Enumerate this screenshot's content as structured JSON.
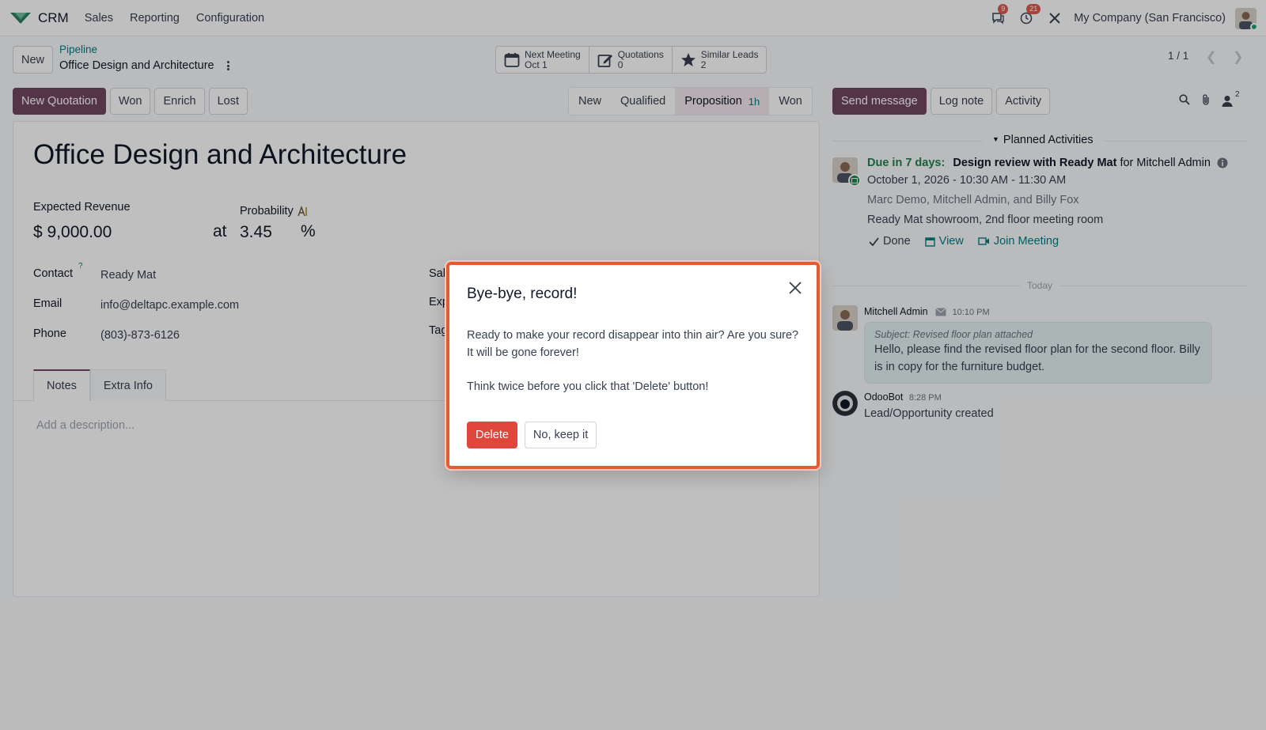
{
  "navbar": {
    "app_name": "CRM",
    "menu": [
      "Sales",
      "Reporting",
      "Configuration"
    ],
    "messages_badge": "9",
    "activities_badge": "21",
    "company": "My Company (San Francisco)"
  },
  "control_panel": {
    "new_label": "New",
    "breadcrumb_parent": "Pipeline",
    "breadcrumb_current": "Office Design and Architecture",
    "smart_buttons": [
      {
        "label": "Next Meeting",
        "value": "Oct 1",
        "icon": "calendar-icon"
      },
      {
        "label": "Quotations",
        "value": "0",
        "icon": "edit-icon"
      },
      {
        "label": "Similar Leads",
        "value": "2",
        "icon": "star-icon"
      }
    ],
    "pager": "1 / 1"
  },
  "status_bar": {
    "actions": [
      "New Quotation",
      "Won",
      "Enrich",
      "Lost"
    ],
    "stages": [
      {
        "label": "New",
        "duration": ""
      },
      {
        "label": "Qualified",
        "duration": ""
      },
      {
        "label": "Proposition",
        "duration": "1h"
      },
      {
        "label": "Won",
        "duration": ""
      }
    ],
    "active_stage": "Proposition"
  },
  "form": {
    "title": "Office Design and Architecture",
    "expected_revenue_label": "Expected Revenue",
    "expected_revenue": "$ 9,000.00",
    "at_label": "at",
    "probability_label": "Probability",
    "probability": "3.45",
    "percent": "%",
    "contact_label": "Contact",
    "contact_help": "?",
    "contact": "Ready Mat",
    "email_label": "Email",
    "email": "info@deltapc.example.com",
    "phone_label": "Phone",
    "phone": "(803)-873-6126",
    "right_labels": [
      "Sal",
      "Exp",
      "Tag"
    ],
    "tabs": [
      "Notes",
      "Extra Info"
    ],
    "description_placeholder": "Add a description..."
  },
  "chatter": {
    "buttons": [
      "Send message",
      "Log note",
      "Activity"
    ],
    "followers_count": "2",
    "planned_title": "Planned Activities",
    "activity": {
      "due": "Due in 7 days:",
      "summary": "Design review with Ready Mat",
      "for_text": "for Mitchell Admin",
      "datetime": "October 1, 2026 - 10:30 AM - 11:30 AM",
      "attendees": "Marc Demo, Mitchell Admin, and Billy Fox",
      "location": "Ready Mat showroom, 2nd floor meeting room",
      "done": "Done",
      "view": "View",
      "join": "Join Meeting"
    },
    "today_label": "Today",
    "messages": [
      {
        "author": "Mitchell Admin",
        "time": "10:10 PM",
        "subject": "Subject: Revised floor plan attached",
        "body": "Hello, please find the revised floor plan for the second floor. Billy is in copy for the furniture budget."
      },
      {
        "author": "OdooBot",
        "time": "8:28 PM",
        "body": "Lead/Opportunity created"
      }
    ]
  },
  "dialog": {
    "title": "Bye-bye, record!",
    "body_1": "Ready to make your record disappear into thin air? Are you sure? It will be gone forever!",
    "body_2": "Think twice before you click that 'Delete' button!",
    "delete_label": "Delete",
    "keep_label": "No, keep it"
  },
  "colors": {
    "brand": "#71465f",
    "link": "#017e84",
    "danger": "#e0463b",
    "dialog_border": "#e25b35",
    "due_green": "#22804f"
  }
}
